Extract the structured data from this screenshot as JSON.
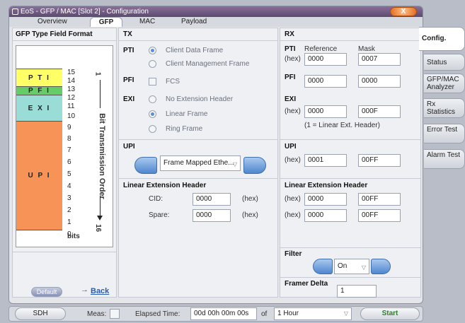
{
  "window": {
    "title": "EoS - GFP / MAC [Slot 2]  -  Configuration",
    "close_label": "X",
    "tabs": [
      "Overview",
      "GFP",
      "MAC",
      "Payload"
    ]
  },
  "diagram": {
    "title": "GFP Type Field Format",
    "blocks": [
      {
        "label": "P T I",
        "color": "#ffff66"
      },
      {
        "label": "P F I",
        "color": "#66cc66"
      },
      {
        "label": "E X I",
        "color": "#99ddd6"
      },
      {
        "label": "U P I",
        "color": "#f79356"
      }
    ],
    "bit_numbers": [
      "15",
      "14",
      "13",
      "12",
      "11",
      "10",
      "9",
      "8",
      "7",
      "6",
      "5",
      "4",
      "3",
      "2",
      "1",
      "0"
    ],
    "bits_label": "bits",
    "order_label": "Bit Transmission Order",
    "order_start": "1",
    "order_end": "16",
    "default_button": "Default",
    "back_link": "Back"
  },
  "tx": {
    "header": "TX",
    "pti_label": "PTI",
    "pti_options": [
      "Client Data Frame",
      "Client Management Frame"
    ],
    "pfi_label": "PFI",
    "pfi_option": "FCS",
    "exi_label": "EXI",
    "exi_options": [
      "No Extension Header",
      "Linear Frame",
      "Ring Frame"
    ],
    "upi_label": "UPI",
    "upi_value": "Frame Mapped Ethe...",
    "linear_header": "Linear Extension Header",
    "cid_label": "CID:",
    "cid_value": "0000",
    "spare_label": "Spare:",
    "spare_value": "0000",
    "hex_label": "(hex)"
  },
  "rx": {
    "header": "RX",
    "pti_label": "PTI",
    "reference_label": "Reference",
    "mask_label": "Mask",
    "hex_label": "(hex)",
    "pti_reference": "0000",
    "pti_mask": "0007",
    "pfi_label": "PFI",
    "pfi_reference": "0000",
    "pfi_mask": "0000",
    "exi_label": "EXI",
    "exi_reference": "0000",
    "exi_mask": "000F",
    "exi_note": "(1 = Linear Ext. Header)",
    "upi_label": "UPI",
    "upi_reference": "0001",
    "upi_mask": "00FF",
    "linear_header": "Linear Extension Header",
    "lin1_reference": "0000",
    "lin1_mask": "00FF",
    "lin2_reference": "0000",
    "lin2_mask": "00FF",
    "filter_label": "Filter",
    "filter_value": "On",
    "framer_delta_label": "Framer Delta",
    "framer_delta_value": "1"
  },
  "side_tabs": [
    "Config.",
    "Status",
    "GFP/MAC Analyzer",
    "Rx Statistics",
    "Error Test",
    "Alarm Test"
  ],
  "status": {
    "sdh": "SDH",
    "meas_label": "Meas:",
    "elapsed_label": "Elapsed Time:",
    "elapsed_value": "00d 00h 00m 00s",
    "of_label": "of",
    "duration": "1 Hour",
    "start": "Start"
  }
}
